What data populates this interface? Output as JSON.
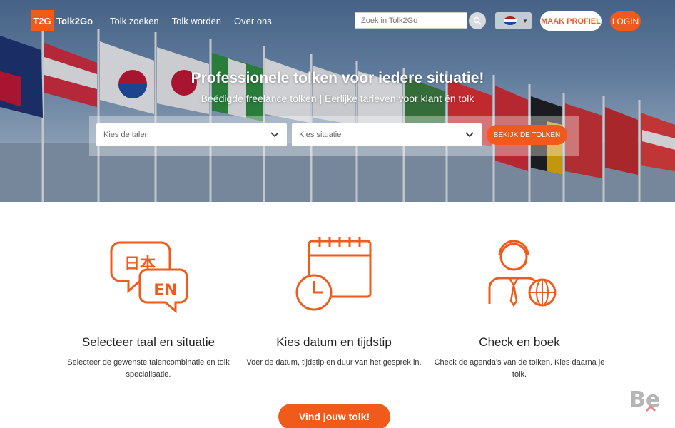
{
  "header": {
    "logo_badge": "T2G",
    "logo_text": "Tolk2Go",
    "nav": [
      "Tolk zoeken",
      "Tolk worden",
      "Over ons"
    ],
    "search_placeholder": "Zoek in Tolk2Go",
    "profile_button": "MAAK PROFIEL",
    "login_button": "LOGIN"
  },
  "hero": {
    "title": "Professionele tolken voor iedere situatie!",
    "subtitle": "Beëdigde freelance tolken | Eerlijke tarieven voor klant én tolk",
    "language_select": "Kies de talen",
    "situation_select": "Kies situatie",
    "find_button": "BEKIJK DE TOLKEN"
  },
  "features": [
    {
      "title": "Selecteer taal en situatie",
      "text": "Selecteer de gewenste talencombinatie en tolk specialisatie.",
      "icon": "translation-bubbles-icon",
      "glyph_a": "日本",
      "glyph_b": "EN"
    },
    {
      "title": "Kies datum en tijdstip",
      "text": "Voer de datum, tijdstip en duur van het gesprek in.",
      "icon": "calendar-clock-icon"
    },
    {
      "title": "Check en boek",
      "text": "Check de agenda's van de tolken. Kies daarna je tolk.",
      "icon": "interpreter-globe-icon"
    }
  ],
  "cta_button": "Vind jouw tolk!",
  "colors": {
    "accent": "#f05a1a"
  }
}
